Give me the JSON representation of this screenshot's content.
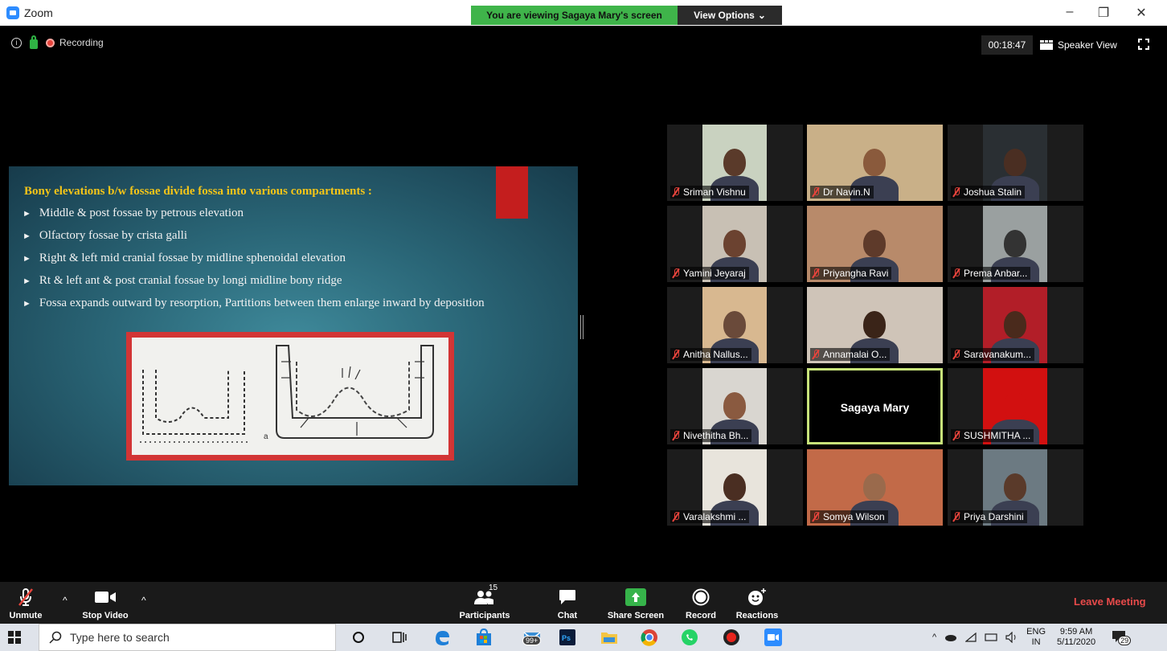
{
  "window": {
    "app_title": "Zoom",
    "minimize": "–",
    "restore": "❐",
    "close": "✕"
  },
  "share_banner": {
    "viewing_text": "You are viewing Sagaya Mary's screen",
    "view_options_label": "View Options",
    "chevron": "⌄"
  },
  "meeting_header": {
    "info_glyph": "i",
    "recording_label": "Recording",
    "timer": "00:18:47",
    "speaker_view_label": "Speaker View"
  },
  "slide": {
    "title": "Bony elevations b/w fossae divide fossa into various compartments :",
    "bullet_glyph": "►",
    "bullets": [
      "Middle & post fossae by petrous elevation",
      "Olfactory fossae by crista galli",
      "Right & left mid cranial fossae by midline sphenoidal elevation",
      "Rt & left ant & post cranial fossae by longi midline bony ridge",
      "Fossa expands outward by resorption, Partitions between them enlarge inward by deposition"
    ],
    "diagram_label": "a"
  },
  "participants": [
    {
      "name": "Sriman Vishnu",
      "skin": "#5a3a2a",
      "bg": "#c9d2c0"
    },
    {
      "name": "Dr Navin.N",
      "skin": "#8a5a3c",
      "bg": "#c9b088"
    },
    {
      "name": "Joshua Stalin",
      "skin": "#4a2e22",
      "bg": "#2a2f33"
    },
    {
      "name": "Yamini Jeyaraj",
      "skin": "#6b4230",
      "bg": "#c8c0b4"
    },
    {
      "name": "Priyangha Ravi",
      "skin": "#5e3a2a",
      "bg": "#b88a6a"
    },
    {
      "name": "Prema Anbar...",
      "skin": "#333333",
      "bg": "#9aa0a0"
    },
    {
      "name": "Anitha Nallus...",
      "skin": "#6a4a3a",
      "bg": "#d8b890"
    },
    {
      "name": "Annamalai O...",
      "skin": "#3a2418",
      "bg": "#cfc4b8"
    },
    {
      "name": "Saravanakum...",
      "skin": "#4a2a1c",
      "bg": "#b21e28"
    },
    {
      "name": "Nivethitha Bh...",
      "skin": "#8a5a40",
      "bg": "#d9d6d0"
    },
    {
      "name": "Sagaya Mary",
      "speaking": true
    },
    {
      "name": "SUSHMITHA ...",
      "skin": "#d21010",
      "bg": "#d21010"
    },
    {
      "name": "Varalakshmi ...",
      "skin": "#4a2e22",
      "bg": "#e8e4dc"
    },
    {
      "name": "Somya Wilson",
      "skin": "#9a6a4c",
      "bg": "#c26a48"
    },
    {
      "name": "Priya Darshini",
      "skin": "#5a3a2a",
      "bg": "#6c7a82"
    }
  ],
  "toolbar": {
    "unmute": "Unmute",
    "stop_video": "Stop Video",
    "participants": "Participants",
    "participants_count": "15",
    "chat": "Chat",
    "share_screen": "Share Screen",
    "record": "Record",
    "reactions": "Reactions",
    "leave": "Leave Meeting",
    "caret": "^"
  },
  "taskbar": {
    "search_placeholder": "Type here to search",
    "store_badge": "99+",
    "language": "ENG",
    "region": "IN",
    "time": "9:59 AM",
    "date": "5/11/2020",
    "notifications": "29"
  }
}
